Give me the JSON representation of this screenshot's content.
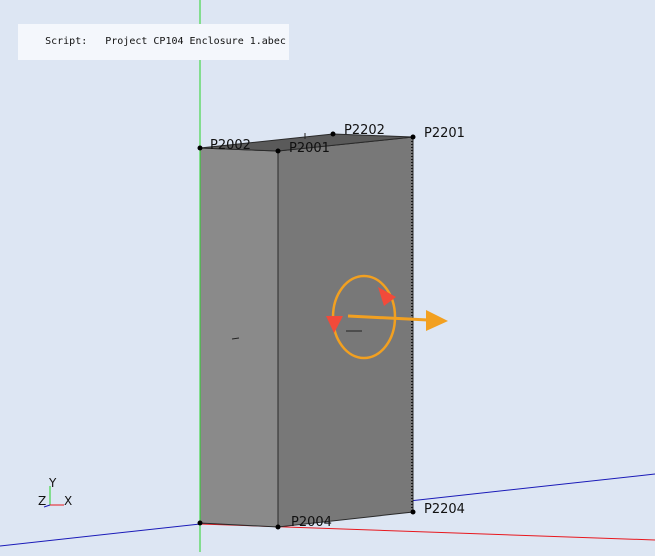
{
  "header": {
    "script_key": "Script:",
    "script_value": "Project CP104 Enclosure 1.abec"
  },
  "points": {
    "p2002": "P2002",
    "p2001": "P2001",
    "p2202": "P2202",
    "p2201": "P2201",
    "p2004": "P2004",
    "p2204": "P2204"
  },
  "axes": {
    "y": "Y",
    "z": "Z",
    "x": "X"
  },
  "colors": {
    "background": "#dde6f3",
    "box_front": "#7a7a7a",
    "box_left": "#8a8a8a",
    "box_top": "#5c5c5c",
    "gizmo": "#f2a020",
    "gizmo_arrow": "#f24a3a",
    "axis_x": "#e8181e",
    "axis_z": "#1a1ab8",
    "axis_y": "#28d428"
  },
  "icons": {
    "rotate_gizmo": "rotate-gizmo-icon",
    "move_arrow": "move-arrow-icon",
    "axis_triad": "axis-triad-icon"
  }
}
